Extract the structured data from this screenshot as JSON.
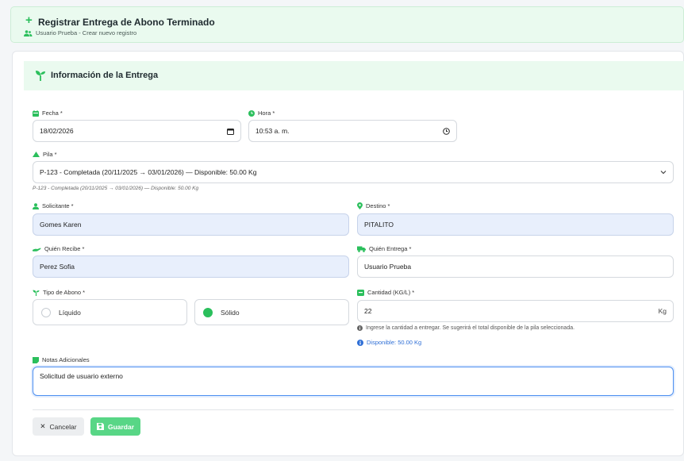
{
  "header": {
    "title": "Registrar Entrega de Abono Terminado",
    "subtitle": "Usuario Prueba - Crear nuevo registro"
  },
  "section": {
    "title": "Información de la Entrega"
  },
  "fecha": {
    "label": "Fecha *",
    "value": "18/02/2026"
  },
  "hora": {
    "label": "Hora *",
    "value": "10:53 a. m."
  },
  "pila": {
    "label": "Pila *",
    "value": "P-123 - Completada (20/11/2025 → 03/01/2026) — Disponible: 50.00 Kg",
    "help": "P-123 - Completada (20/11/2025 → 03/01/2026) — Disponible: 50.00 Kg"
  },
  "solicitante": {
    "label": "Solicitante *",
    "value": "Gomes Karen"
  },
  "destino": {
    "label": "Destino *",
    "value": "PITALITO"
  },
  "quien_recibe": {
    "label": "Quién Recibe *",
    "value": "Perez Sofia"
  },
  "quien_entrega": {
    "label": "Quién Entrega *",
    "value": "Usuario Prueba"
  },
  "tipo_abono": {
    "label": "Tipo de Abono *",
    "options": [
      {
        "label": "Líquido",
        "selected": false
      },
      {
        "label": "Sólido",
        "selected": true
      }
    ]
  },
  "cantidad": {
    "label": "Cantidad (KG/L) *",
    "value": "22",
    "unit": "Kg",
    "hint": "Ingrese la cantidad a entregar. Se sugerirá el total disponible de la pila seleccionada.",
    "available": "Disponible: 50.00 Kg"
  },
  "notas": {
    "label": "Notas Adicionales",
    "value": "Solicitud de usuario externo"
  },
  "actions": {
    "cancel": "Cancelar",
    "save": "Guardar"
  },
  "colors": {
    "accent": "#2bbf5c",
    "info": "#2f6fd6",
    "readonly_bg": "#e8effc",
    "save_bg": "#58d686"
  }
}
